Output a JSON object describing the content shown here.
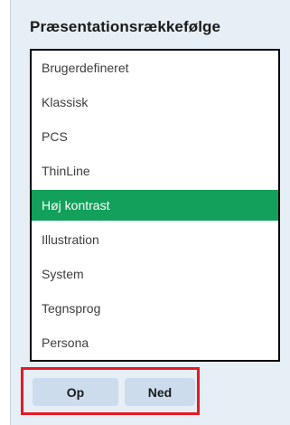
{
  "panel": {
    "title": "Præsentationsrækkefølge",
    "items": [
      {
        "label": "Brugerdefineret",
        "selected": false
      },
      {
        "label": "Klassisk",
        "selected": false
      },
      {
        "label": "PCS",
        "selected": false
      },
      {
        "label": "ThinLine",
        "selected": false
      },
      {
        "label": "Høj kontrast",
        "selected": true
      },
      {
        "label": "Illustration",
        "selected": false
      },
      {
        "label": "System",
        "selected": false
      },
      {
        "label": "Tegnsprog",
        "selected": false
      },
      {
        "label": "Persona",
        "selected": false
      }
    ],
    "buttons": {
      "up_label": "Op",
      "down_label": "Ned"
    }
  },
  "colors": {
    "panel_background": "#e6eef6",
    "selected_background": "#12a05a",
    "button_background": "#ccdced",
    "highlight_border": "#e51a23"
  }
}
